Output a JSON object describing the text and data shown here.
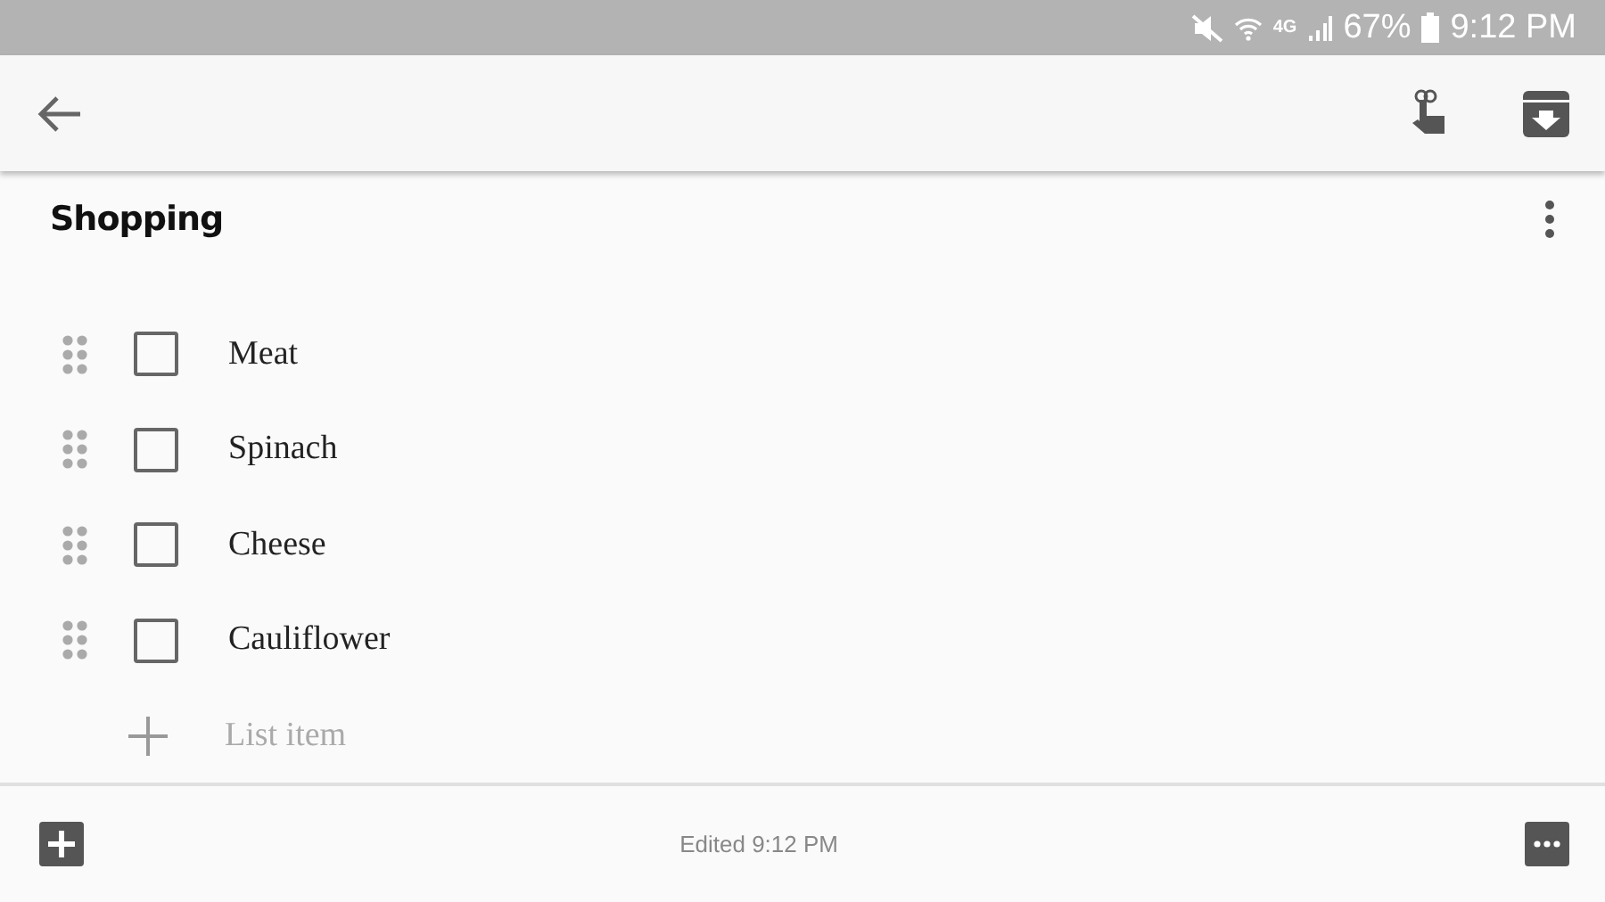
{
  "status_bar": {
    "network": "4G",
    "battery": "67%",
    "time": "9:12 PM"
  },
  "note": {
    "title": "Shopping",
    "items": [
      {
        "text": "Meat",
        "checked": false
      },
      {
        "text": "Spinach",
        "checked": false
      },
      {
        "text": "Cheese",
        "checked": false
      },
      {
        "text": "Cauliflower",
        "checked": false
      }
    ],
    "add_item": {
      "placeholder": "List item"
    }
  },
  "footer": {
    "edited": "Edited 9:12 PM"
  }
}
